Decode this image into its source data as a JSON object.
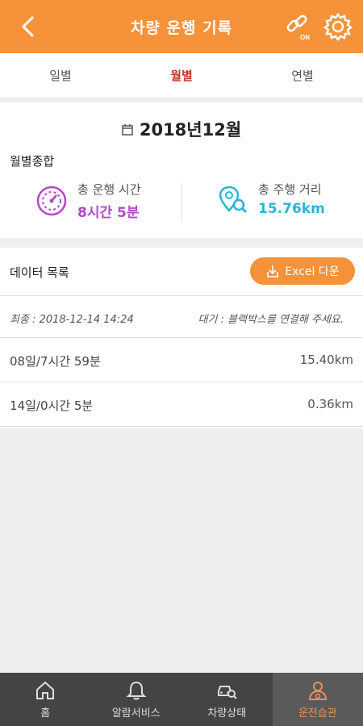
{
  "header": {
    "title": "차량 운행 기록"
  },
  "tabs": [
    {
      "label": "일별",
      "active": false
    },
    {
      "label": "월별",
      "active": true
    },
    {
      "label": "연별",
      "active": false
    }
  ],
  "summary": {
    "month": "2018년12월",
    "title": "월별종합",
    "drive_time": {
      "label": "총 운행 시간",
      "value": "8시간 5분",
      "color": "#b148c9"
    },
    "drive_distance": {
      "label": "총 주행 거리",
      "value": "15.76km",
      "color": "#29b5d6"
    }
  },
  "datalist": {
    "title": "데이터 목록",
    "excel_label": "Excel 다운",
    "status_left": "최종 : 2018-12-14 14:24",
    "status_right": "대기 : 블랙박스를 연결해 주세요.",
    "rows": [
      {
        "left": "08일/7시간 59분",
        "right": "15.40km"
      },
      {
        "left": "14일/0시간 5분",
        "right": "0.36km"
      }
    ]
  },
  "nav": [
    {
      "label": "홈",
      "icon": "home-icon"
    },
    {
      "label": "알람서비스",
      "icon": "bell-icon"
    },
    {
      "label": "차량상태",
      "icon": "car-search-icon"
    },
    {
      "label": "운전습관",
      "icon": "driver-icon",
      "active": true
    }
  ],
  "colors": {
    "accent": "#f5923a",
    "nav_bg": "#444444",
    "active_tab": "#c0392b"
  }
}
